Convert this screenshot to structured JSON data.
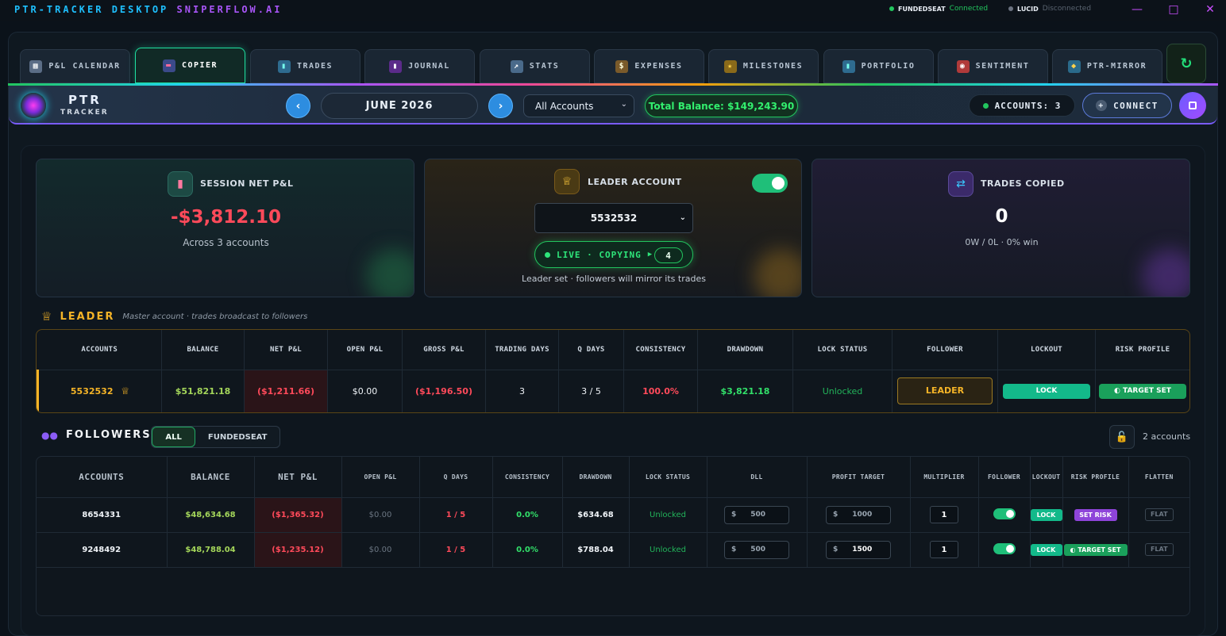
{
  "titlebar": {
    "title_main": "PTR-TRACKER DESKTOP",
    "title_sub": "SNIPERFLOW.AI",
    "connections": [
      {
        "name": "FUNDEDSEAT",
        "status": "Connected"
      },
      {
        "name": "LUCID",
        "status": "Disconnected"
      }
    ]
  },
  "tabs": [
    {
      "label": "P&L CALENDAR",
      "icon": "calendar-icon"
    },
    {
      "label": "COPIER",
      "icon": "copier-icon",
      "active": true
    },
    {
      "label": "TRADES",
      "icon": "chart-icon"
    },
    {
      "label": "JOURNAL",
      "icon": "book-icon"
    },
    {
      "label": "STATS",
      "icon": "stats-icon"
    },
    {
      "label": "EXPENSES",
      "icon": "money-bag-icon"
    },
    {
      "label": "MILESTONES",
      "icon": "trophy-icon"
    },
    {
      "label": "PORTFOLIO",
      "icon": "portfolio-icon"
    },
    {
      "label": "SENTIMENT",
      "icon": "target-icon"
    },
    {
      "label": "PTR-MIRROR",
      "icon": "mirror-icon"
    }
  ],
  "header": {
    "logo_line1": "PTR",
    "logo_line2": "TRACKER",
    "prev": "‹",
    "next": "›",
    "month": "JUNE 2026",
    "account_filter": "All Accounts",
    "total_balance": "Total Balance: $149,243.90",
    "accounts_count": "ACCOUNTS: 3",
    "connect": "CONNECT"
  },
  "cards": {
    "session": {
      "title": "SESSION NET P&L",
      "value": "-$3,812.10",
      "sub": "Across 3 accounts"
    },
    "leader": {
      "title": "LEADER ACCOUNT",
      "selected": "5532532",
      "live": "LIVE · COPYING",
      "count": "4",
      "note": "Leader set · followers will mirror its trades",
      "enabled": true
    },
    "copied": {
      "title": "TRADES COPIED",
      "value": "0",
      "sub": "0W / 0L · 0% win"
    }
  },
  "leader_section": {
    "title": "LEADER",
    "desc": "Master account · trades broadcast to followers",
    "headers": [
      "ACCOUNTS",
      "BALANCE",
      "NET P&L",
      "OPEN P&L",
      "GROSS P&L",
      "TRADING DAYS",
      "Q DAYS",
      "CONSISTENCY",
      "DRAWDOWN",
      "LOCK STATUS",
      "FOLLOWER",
      "LOCKOUT",
      "RISK PROFILE"
    ],
    "row": {
      "account": "5532532",
      "balance": "$51,821.18",
      "net_pl": "($1,211.66)",
      "open_pl": "$0.00",
      "gross_pl": "($1,196.50)",
      "trading_days": "3",
      "q_days": "3 / 5",
      "consistency": "100.0%",
      "drawdown": "$3,821.18",
      "lock_status": "Unlocked",
      "follower": "LEADER",
      "lockout": "LOCK",
      "risk_profile": "TARGET SET"
    }
  },
  "followers_section": {
    "title": "FOLLOWERS",
    "filters": [
      "ALL",
      "FUNDEDSEAT"
    ],
    "account_count": "2 accounts",
    "headers": [
      "ACCOUNTS",
      "BALANCE",
      "NET P&L",
      "OPEN P&L",
      "Q DAYS",
      "CONSISTENCY",
      "DRAWDOWN",
      "LOCK STATUS",
      "DLL",
      "PROFIT TARGET",
      "MULTIPLIER",
      "FOLLOWER",
      "LOCKOUT",
      "RISK PROFILE",
      "FLATTEN"
    ],
    "rows": [
      {
        "account": "8654331",
        "balance": "$48,634.68",
        "net_pl": "($1,365.32)",
        "open_pl": "$0.00",
        "q_days": "1 / 5",
        "consistency": "0.0%",
        "drawdown": "$634.68",
        "lock_status": "Unlocked",
        "dll_prefix": "$",
        "dll": "500",
        "pt_prefix": "$",
        "profit_target": "1000",
        "multiplier": "1",
        "follower_on": true,
        "lockout": "LOCK",
        "risk_profile": "SET RISK",
        "flatten": "FLAT"
      },
      {
        "account": "9248492",
        "balance": "$48,788.04",
        "net_pl": "($1,235.12)",
        "open_pl": "$0.00",
        "q_days": "1 / 5",
        "consistency": "0.0%",
        "drawdown": "$788.04",
        "lock_status": "Unlocked",
        "dll_prefix": "$",
        "dll": "500",
        "pt_prefix": "$",
        "profit_target": "1500",
        "multiplier": "1",
        "follower_on": true,
        "lockout": "LOCK",
        "risk_profile": "TARGET SET",
        "flatten": "FLAT"
      }
    ]
  }
}
